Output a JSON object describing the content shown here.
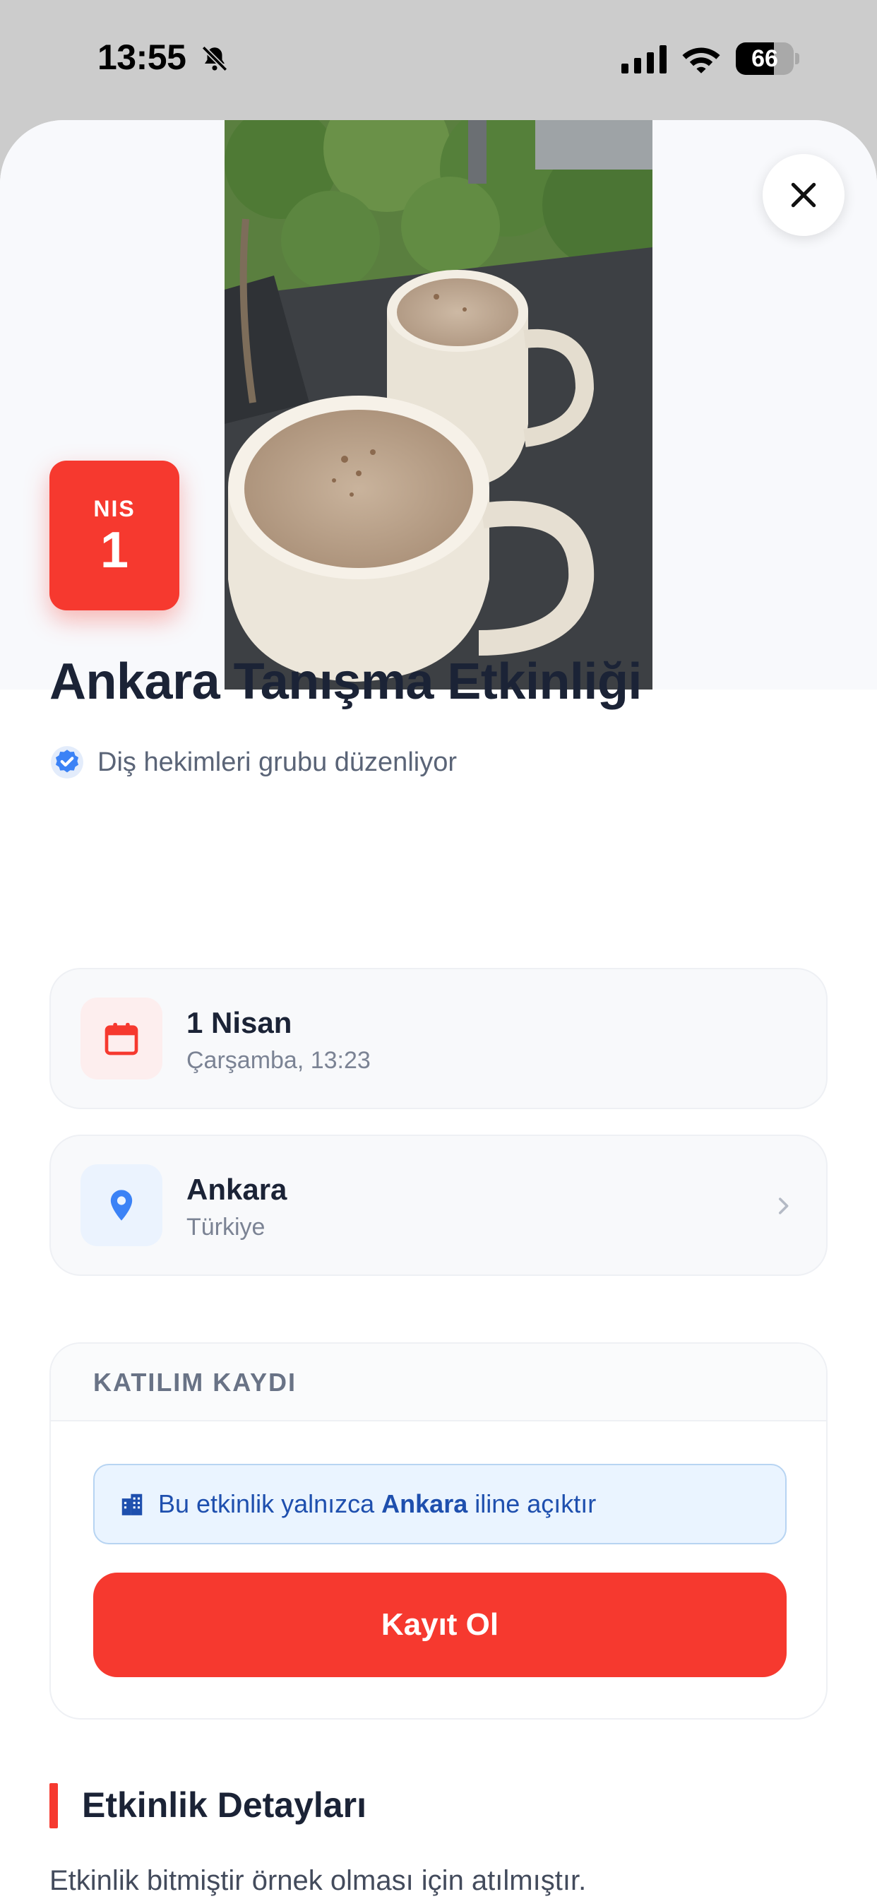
{
  "status_bar": {
    "time": "13:55",
    "battery": {
      "level_text": "66",
      "level": 0.66
    }
  },
  "event": {
    "date_badge": {
      "month": "NIS",
      "day": "1"
    },
    "title": "Ankara Tanışma Etkinliği",
    "organizer": "Diş hekimleri grubu düzenliyor",
    "date_card": {
      "title": "1 Nisan",
      "subtitle": "Çarşamba, 13:23",
      "icon": "calendar-icon"
    },
    "location_card": {
      "title": "Ankara",
      "subtitle": "Türkiye",
      "icon": "location-pin-icon"
    }
  },
  "registration": {
    "header": "KATILIM KAYDI",
    "notice": {
      "before": "Bu etkinlik yalnızca ",
      "city": "Ankara",
      "after": " iline açıktır"
    },
    "button_label": "Kayıt Ol"
  },
  "details": {
    "heading": "Etkinlik Detayları",
    "description": "Etkinlik bitmiştir örnek olması için atılmıştır."
  },
  "colors": {
    "accent": "#f6392f",
    "title": "#1b2336",
    "info_blue": "#3b82f6",
    "notice_bg": "#eaf4ff"
  }
}
